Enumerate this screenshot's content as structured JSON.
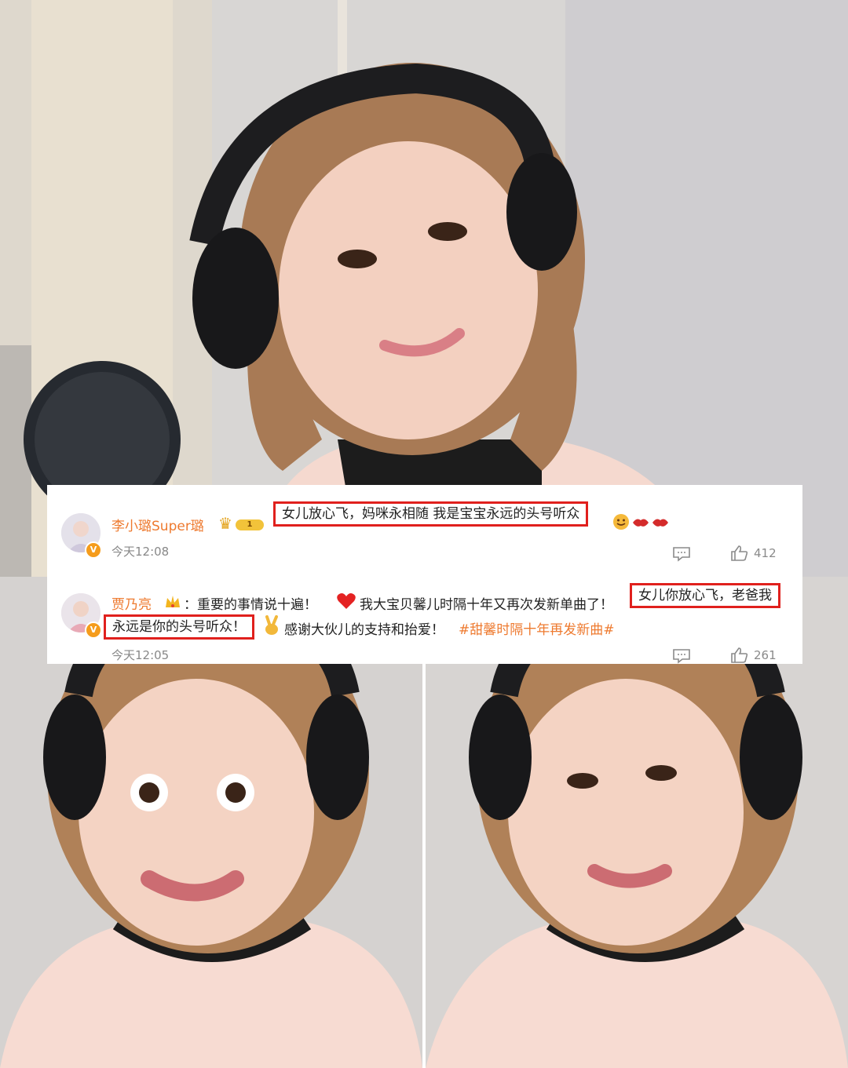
{
  "comments": [
    {
      "username": "李小璐Super璐",
      "member_level": "1",
      "text_highlight": "女儿放心飞，妈咪永相随 我是宝宝永远的头号听众",
      "emoji_icons": [
        "smiling-face-icon",
        "red-lips-icon",
        "red-lips-icon"
      ],
      "time": "今天12:08",
      "likes": "412",
      "verified": "V"
    },
    {
      "username": "贾乃亮",
      "text_part1": "：重要的事情说十遍！",
      "text_part2": "我大宝贝馨儿时隔十年又再次发新单曲了！",
      "text_highlight_a": "女儿你放心飞，老爸我",
      "text_highlight_b": "永远是你的头号听众！",
      "text_part3": "感谢大伙儿的支持和抬爱！",
      "hashtag": "#甜馨时隔十年再发新曲#",
      "time": "今天12:05",
      "likes": "261",
      "verified": "V"
    }
  ],
  "colors": {
    "username": "#ee7a2f",
    "highlight_border": "#e0201d",
    "meta_text": "#888888"
  }
}
